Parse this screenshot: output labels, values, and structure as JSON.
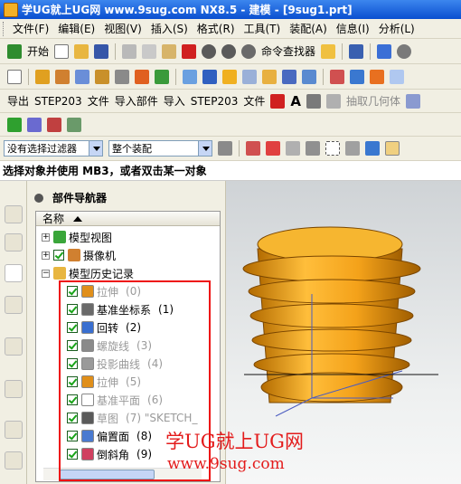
{
  "window": {
    "title": "学UG就上UG网 www.9sug.com NX8.5 - 建模 - [9sug1.prt]"
  },
  "menu": [
    "文件(F)",
    "编辑(E)",
    "视图(V)",
    "插入(S)",
    "格式(R)",
    "工具(T)",
    "装配(A)",
    "信息(I)",
    "分析(L)"
  ],
  "toolbar1": {
    "start_label": "开始",
    "command_finder_label": "命令查找器"
  },
  "toolbar3": {
    "labels": [
      "导出",
      "STEP203",
      "文件",
      "导入部件",
      "导入",
      "STEP203",
      "文件"
    ],
    "extract_label": "抽取几何体"
  },
  "selection_bar": {
    "filter_value": "没有选择过滤器",
    "scope_value": "整个装配"
  },
  "cue_line": "选择对象并使用 MB3，或者双击某一对象",
  "navigator": {
    "title": "部件导航器",
    "column_header": "名称",
    "top_nodes": [
      {
        "label": "模型视图"
      },
      {
        "label": "摄像机"
      },
      {
        "label": "模型历史记录"
      }
    ],
    "features": [
      {
        "label": "拉伸",
        "num": "(0)",
        "faded": true
      },
      {
        "label": "基准坐标系",
        "num": "(1)",
        "faded": false
      },
      {
        "label": "回转",
        "num": "(2)",
        "faded": false
      },
      {
        "label": "螺旋线",
        "num": "(3)",
        "faded": true
      },
      {
        "label": "投影曲线",
        "num": "(4)",
        "faded": true
      },
      {
        "label": "拉伸",
        "num": "(5)",
        "faded": true
      },
      {
        "label": "基准平面",
        "num": "(6)",
        "faded": true
      },
      {
        "label": "草图",
        "num": "(7) \"SKETCH_",
        "faded": true
      },
      {
        "label": "偏置面",
        "num": "(8)",
        "faded": false
      },
      {
        "label": "倒斜角",
        "num": "(9)",
        "faded": false
      }
    ]
  },
  "watermark": {
    "line1": "学UG就上UG网",
    "line2": "www.9sug.com"
  },
  "colors": {
    "title_bar": "#0a4fd0",
    "highlight_box": "#e11111",
    "part": "#f3a20f",
    "watermark": "#e31b1b"
  }
}
